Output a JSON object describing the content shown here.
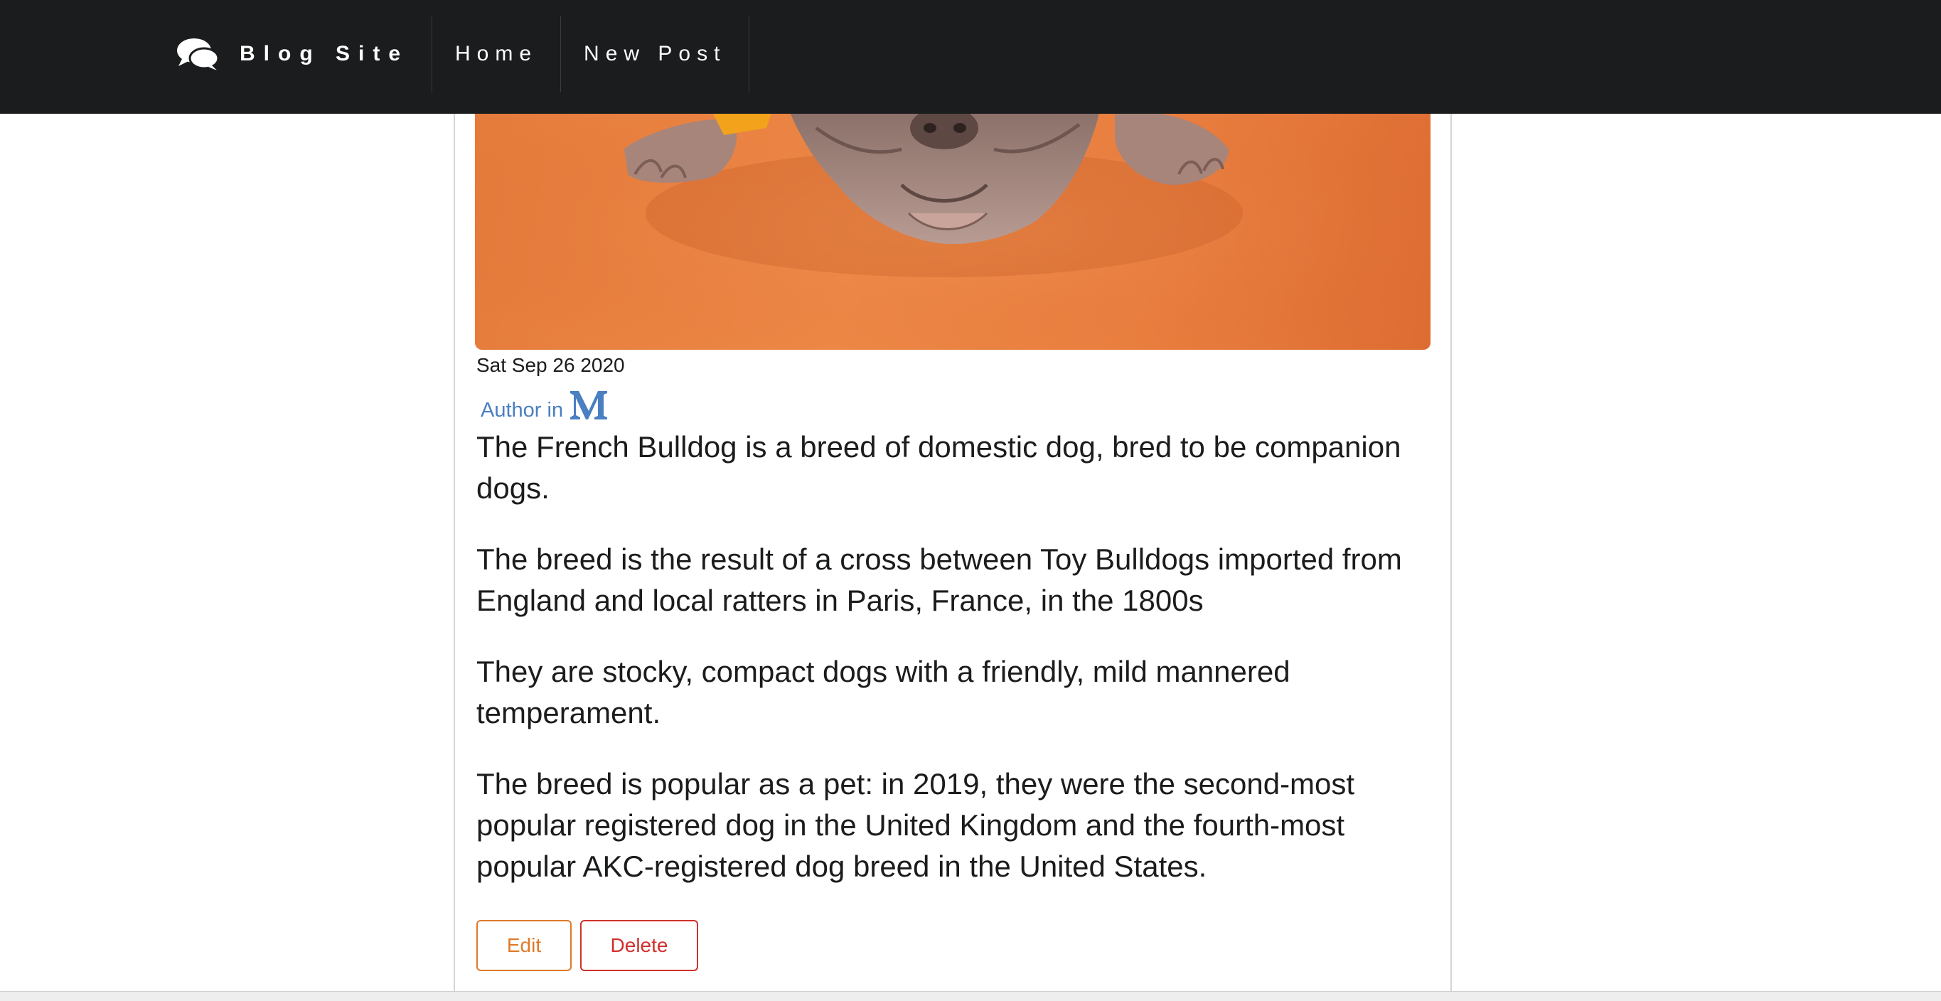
{
  "nav": {
    "brand": "Blog Site",
    "brand_icon": "comments-icon",
    "items": [
      {
        "label": "Home"
      },
      {
        "label": "New Post"
      }
    ]
  },
  "post": {
    "image_subject": "dog-image",
    "date": "Sat Sep 26 2020",
    "author_text": "Author in",
    "author_icon": "medium-icon",
    "paragraphs": [
      "The French Bulldog is a breed of domestic dog, bred to be companion dogs.",
      "The breed is the result of a cross between Toy Bulldogs imported from England and local ratters in Paris, France, in the 1800s",
      "They are stocky, compact dogs with a friendly, mild mannered temperament.",
      "The breed is popular as a pet: in 2019, they were the second-most popular registered dog in the United Kingdom and the fourth-most popular AKC-registered dog breed in the United States."
    ],
    "actions": {
      "edit": "Edit",
      "delete": "Delete"
    }
  },
  "colors": {
    "nav_bg": "#1b1c1d",
    "link": "#4a7fc1",
    "edit": "#e07a2a",
    "delete": "#d0312d",
    "hero_bg": "#ee8a48"
  }
}
